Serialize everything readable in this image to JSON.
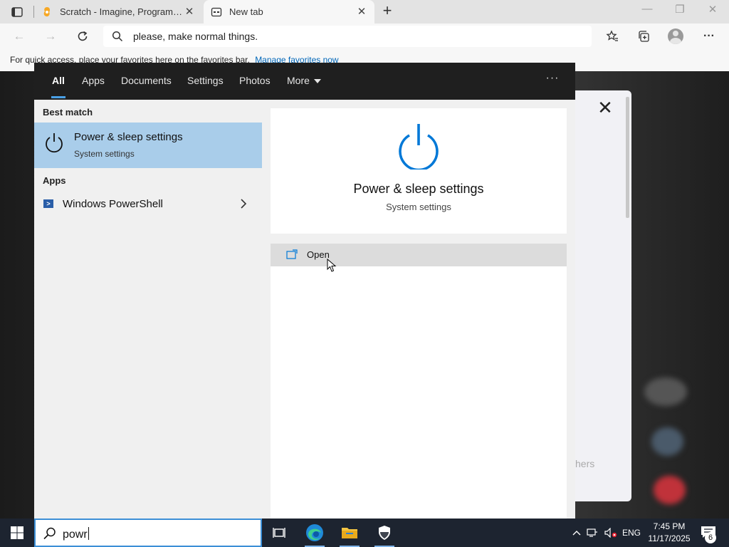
{
  "browser": {
    "tabs": [
      {
        "title": "Scratch - Imagine, Program, Share",
        "active": false
      },
      {
        "title": "New tab",
        "active": true
      }
    ],
    "address_text": "please, make normal things.",
    "favbar_text": "For quick access, place your favorites here on the favorites bar.",
    "favbar_link": "Manage favorites now"
  },
  "background_page": {
    "partial_text": "hers"
  },
  "search": {
    "tabs": [
      {
        "label": "All",
        "active": true
      },
      {
        "label": "Apps"
      },
      {
        "label": "Documents"
      },
      {
        "label": "Settings"
      },
      {
        "label": "Photos"
      },
      {
        "label": "More",
        "dropdown": true
      }
    ],
    "best_match_heading": "Best match",
    "best_match": {
      "title": "Power & sleep settings",
      "subtitle": "System settings",
      "icon": "power-icon"
    },
    "apps_heading": "Apps",
    "apps": [
      {
        "label": "Windows PowerShell",
        "icon": "powershell-icon"
      }
    ],
    "detail": {
      "title": "Power & sleep settings",
      "subtitle": "System settings",
      "actions": [
        {
          "label": "Open",
          "icon": "open-window-icon"
        }
      ]
    },
    "query": "powr"
  },
  "taskbar": {
    "apps": [
      "task-view-icon",
      "edge-icon",
      "file-explorer-icon",
      "security-icon"
    ],
    "language": "ENG",
    "time": "7:45 PM",
    "date": "11/17/2025",
    "notification_count": "6"
  },
  "colors": {
    "accent": "#0078d7",
    "selection": "#a9cdea",
    "taskbar": "#1d2430",
    "search_header": "#1f1f1f"
  }
}
